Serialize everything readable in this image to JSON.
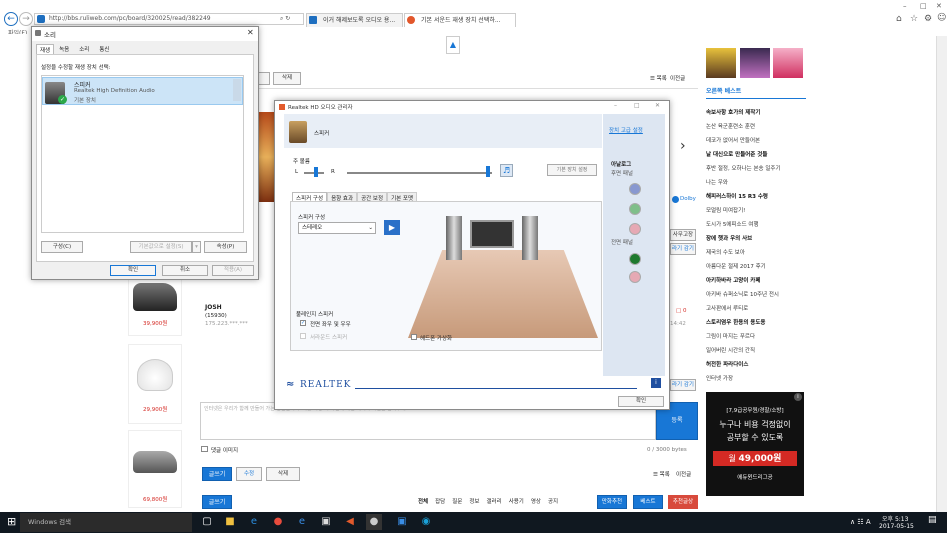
{
  "browser": {
    "address": "http://bbs.ruliweb.com/pc/board/320025/read/382249",
    "address_controls": "⌕ ↻",
    "tabs": [
      {
        "label": "이거 해제보도록 오디오 용..."
      },
      {
        "label": "기본 서운드 재생 장치 선택하..."
      }
    ],
    "menu_file": "파일(F)",
    "window_controls": [
      "–",
      "□",
      "✕"
    ]
  },
  "sound_dialog": {
    "title": "소리",
    "tabs": [
      "재생",
      "녹음",
      "소리",
      "통신"
    ],
    "instruction": "설정을 수정할 재생 장치 선택:",
    "device": {
      "name": "스피커",
      "driver": "Realtek High Definition Audio",
      "status": "기본 장치"
    },
    "configure": "구성(C)",
    "set_default": "기본값으로 설정(S)",
    "properties": "속성(P)",
    "ok": "확인",
    "cancel": "취소",
    "apply": "적용(A)"
  },
  "realtek": {
    "title": "Realtek HD 오디오 관리자",
    "device_tab": "스피커",
    "advanced_link": "장치 고급 설정",
    "main_volume": "주 볼륨",
    "left": "L",
    "right": "R",
    "default_device_btn": "기본 장치 설정",
    "sub_tabs": [
      "스피커 구성",
      "음향 효과",
      "공간 보정",
      "기본 포맷"
    ],
    "speaker_config_label": "스피커 구성",
    "speaker_config_value": "스테레오",
    "fullrange_label": "풀레인지 스피커",
    "front_lr": "전면 좌우 및 우우",
    "surround": "서라운드 스피커",
    "headphone_virtual": "헤드폰 가상화",
    "analog": "아날로그",
    "rear_panel": "후면 패널",
    "front_panel": "전면 패널",
    "brand": "REALTEK",
    "ok": "확인",
    "win_controls": [
      "–",
      "□",
      "✕"
    ]
  },
  "page": {
    "delete_btn": "삭제",
    "list_label": "☰ 목록",
    "prev_label": "이전글",
    "user": "JOSH",
    "user_id": "(15930)",
    "user_ip": "175.223.***.***",
    "time": "14:42",
    "comment_vote": "□ 0",
    "product_prices": [
      "39,900원",
      "29,900원",
      "69,800원"
    ],
    "comment_placeholder": "인터넷은 우리가 함께 만들어 가는 공간입니다. 악플 작성 시 타인에 대한 배려와 책임을 담아주세요",
    "comment_image": "댓글 이미지",
    "byte_count": "0 / 3000 bytes",
    "register": "등록",
    "write": "글쓰기",
    "edit": "수정",
    "delete": "삭제",
    "list": "☰ 목록",
    "prev": "이전글",
    "filters": [
      "전체",
      "잡담",
      "질문",
      "정보",
      "갤러리",
      "사용기",
      "영상",
      "공지"
    ],
    "best_tabs": [
      "만화추천",
      "베스트",
      "추천글상"
    ],
    "side_buttons": [
      "사무고장",
      "라기 감기",
      "라기 감기"
    ],
    "dolby": "Dolby"
  },
  "sidebar": {
    "header": "오른쪽 베스트",
    "items": [
      {
        "text": "속보사항 호가의 제작기",
        "bold": true
      },
      {
        "text": "논산 육군훈련소 훈련",
        "bold": false
      },
      {
        "text": "데코가 없어서 만들어본",
        "bold": false
      },
      {
        "text": "날 대신으로 만들어준 것들",
        "bold": true
      },
      {
        "text": "후반 절정, 오하나는 본송 일주기",
        "bold": false
      },
      {
        "text": "나는 우와",
        "bold": false
      },
      {
        "text": "해피러스하이 15 R3 수령",
        "bold": true
      },
      {
        "text": "모얼림 미여잡기!",
        "bold": false
      },
      {
        "text": "도시가 5에피소드 여행",
        "bold": false
      },
      {
        "text": "장에 햇과 우의 사브",
        "bold": true
      },
      {
        "text": "제국의 수도 보아",
        "bold": false
      },
      {
        "text": "아름다운 절제 2017 후기",
        "bold": false
      },
      {
        "text": "아키하바라 고양이 카페",
        "bold": true
      },
      {
        "text": "아키바 슈퍼소닉로 10주년 전시",
        "bold": false
      },
      {
        "text": "고사판에서 루티로",
        "bold": false
      },
      {
        "text": "스토리염우 한용의 용도용",
        "bold": true
      },
      {
        "text": "그림이 마지는 푸르다",
        "bold": false
      },
      {
        "text": "일어버린 시간의 간직",
        "bold": false
      },
      {
        "text": "허전한 파라다이스",
        "bold": true
      },
      {
        "text": "인터넷 가장",
        "bold": false
      }
    ]
  },
  "ad": {
    "line1": "[7,9급공무원/경찰/소방]",
    "line2": "누구나 비용 걱정없이",
    "line3": "공부할 수 있도록",
    "price_prefix": "월",
    "price": "49,000원",
    "brand": "에듀윈드리그공",
    "badge": "i"
  },
  "taskbar": {
    "search": "Windows 검색",
    "tray": "∧ ☷ A",
    "time": "오후 5:13",
    "date": "2017-05-15"
  },
  "colors": {
    "accent": "#1877d6",
    "realtek_blue": "#1f4fa0",
    "ad_red": "#d42a24"
  }
}
